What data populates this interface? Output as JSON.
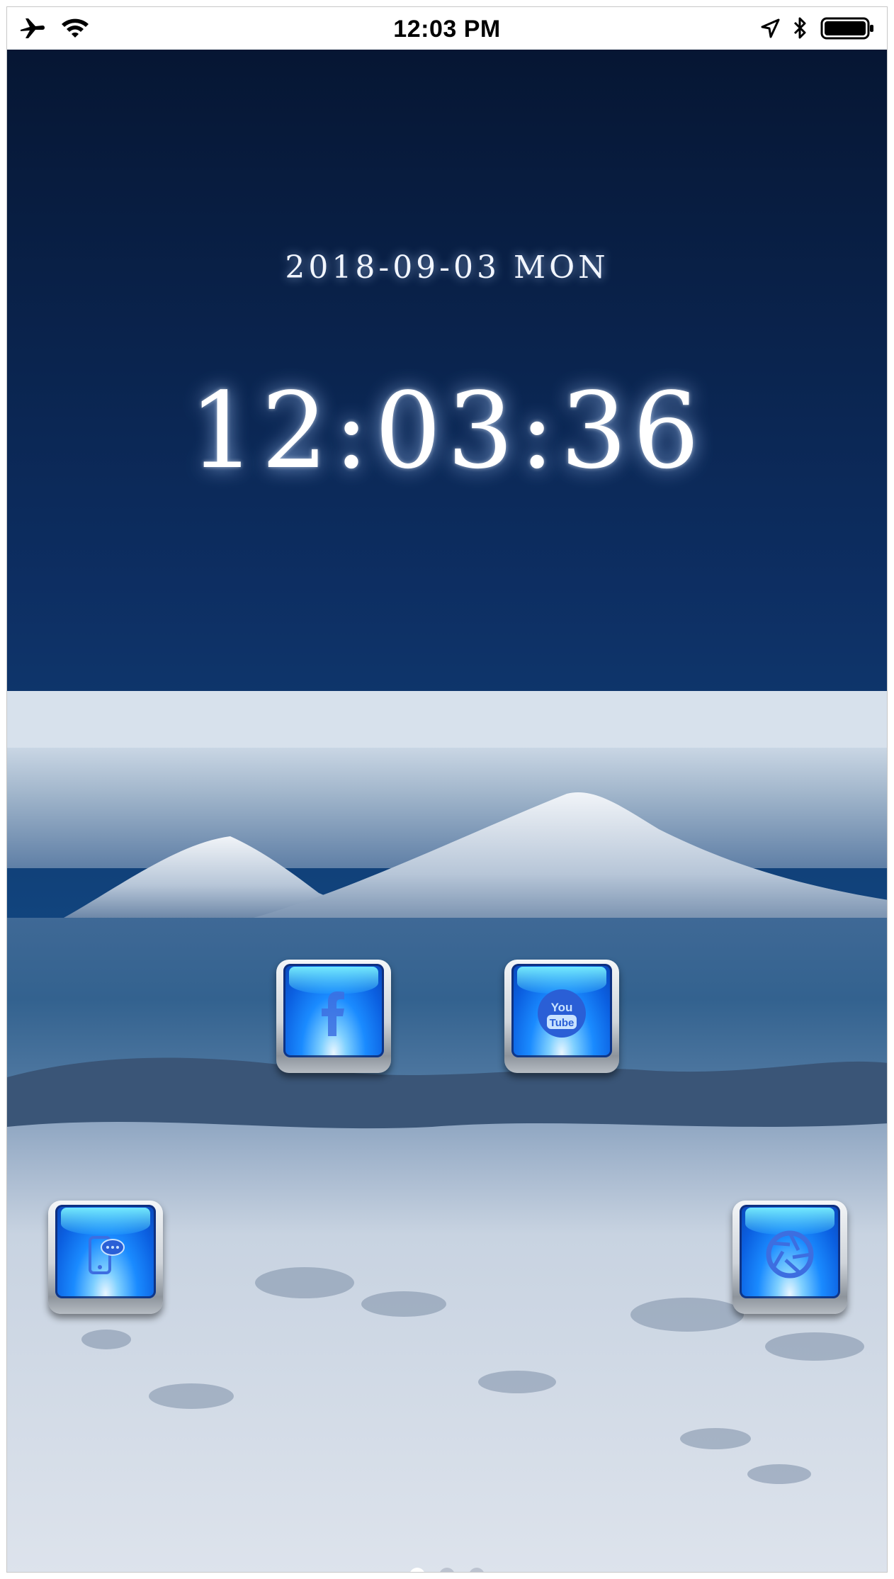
{
  "status_bar": {
    "time": "12:03 PM",
    "icons": [
      "airplane-icon",
      "wifi-icon",
      "location-arrow-icon",
      "bluetooth-icon",
      "battery-icon"
    ]
  },
  "lockscreen": {
    "date": "2018-09-03 MON",
    "clock": "12:03:36"
  },
  "apps": [
    {
      "name": "facebook",
      "icon": "facebook-icon"
    },
    {
      "name": "youtube",
      "icon": "youtube-icon",
      "label": "You Tube"
    },
    {
      "name": "messages",
      "icon": "phone-chat-icon"
    },
    {
      "name": "photos",
      "icon": "aperture-icon"
    }
  ],
  "page_indicator": {
    "count": 3,
    "active": 1
  },
  "colors": {
    "accent": "#1a8bff",
    "sky": "#0b2a5a"
  }
}
